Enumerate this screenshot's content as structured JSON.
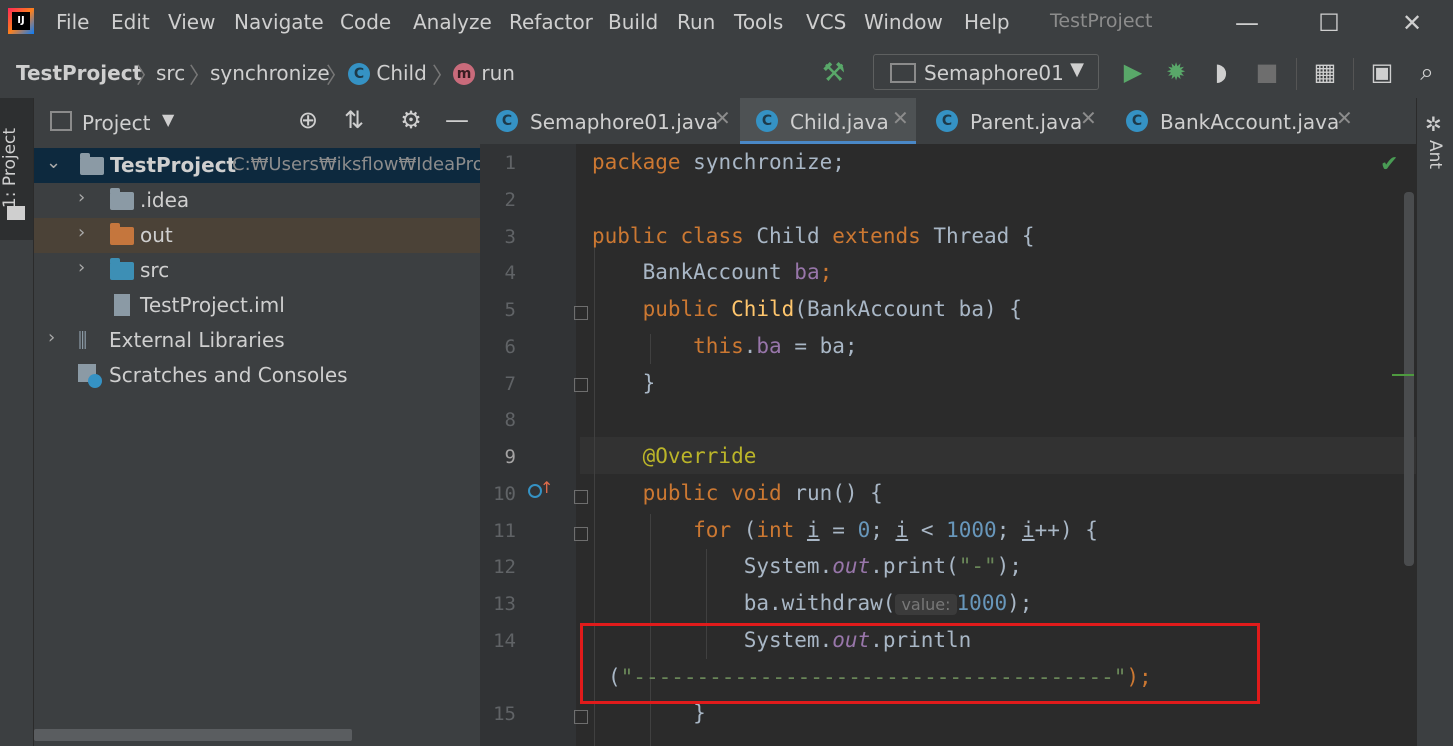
{
  "menubar": {
    "items": [
      "File",
      "Edit",
      "View",
      "Navigate",
      "Code",
      "Analyze",
      "Refactor",
      "Build",
      "Run",
      "Tools",
      "VCS",
      "Window",
      "Help"
    ],
    "window_title": "TestProject",
    "controls": {
      "minimize": "—",
      "maximize": "☐",
      "close": "✕"
    }
  },
  "breadcrumb": {
    "project": "TestProject",
    "folder": "src",
    "package": "synchronize",
    "class": "Child",
    "method": "run",
    "class_icon_letter": "C",
    "method_icon_letter": "m"
  },
  "toolbar": {
    "run_config": "Semaphore01",
    "icons": [
      "build-hammer-icon",
      "run-icon",
      "debug-icon",
      "coverage-icon",
      "stop-icon",
      "project-structure-icon",
      "terminal-icon",
      "search-icon"
    ]
  },
  "left_strip": {
    "tab_label": "1: Project"
  },
  "project_panel": {
    "title": "Project",
    "tree": [
      {
        "label": "TestProject",
        "path": "C:₩Users₩iksflow₩IdeaPro",
        "expanded": true
      },
      {
        "label": ".idea"
      },
      {
        "label": "out"
      },
      {
        "label": "src"
      },
      {
        "label": "TestProject.iml"
      },
      {
        "label": "External Libraries"
      },
      {
        "label": "Scratches and Consoles"
      }
    ]
  },
  "editor_tabs": [
    {
      "label": "Semaphore01.java",
      "active": false
    },
    {
      "label": "Child.java",
      "active": true
    },
    {
      "label": "Parent.java",
      "active": false
    },
    {
      "label": "BankAccount.java",
      "active": false
    }
  ],
  "editor": {
    "line_numbers": [
      "1",
      "2",
      "3",
      "4",
      "5",
      "6",
      "7",
      "8",
      "9",
      "10",
      "11",
      "12",
      "13",
      "14",
      "15"
    ],
    "current_line": "9",
    "code": {
      "l1_kw": "package",
      "l1_rest": " synchronize;",
      "l3_kw1": "public",
      "l3_kw2": "class",
      "l3_name": " Child ",
      "l3_kw3": "extends",
      "l3_rest": " Thread {",
      "l4_type": "BankAccount ",
      "l4_field": "ba",
      "l4_end": ";",
      "l5_kw": "public",
      "l5_name": "Child",
      "l5_rest": "(BankAccount ba) {",
      "l6_kw": "this",
      "l6_dot": ".",
      "l6_field": "ba",
      "l6_rest": " = ba;",
      "l7": "}",
      "l9_ann": "@Override",
      "l10_kw1": "public",
      "l10_kw2": "void",
      "l10_rest": " run() {",
      "l11_kw": "for",
      "l11_a": " (",
      "l11_int": "int",
      "l11_b": " ",
      "l11_i1": "i",
      "l11_c": " = ",
      "l11_n0": "0",
      "l11_d": "; ",
      "l11_i2": "i",
      "l11_e": " < ",
      "l11_n1000": "1000",
      "l11_f": "; ",
      "l11_i3": "i",
      "l11_g": "++) {",
      "l12_a": "System.",
      "l12_out": "out",
      "l12_b": ".print(",
      "l12_str": "\"-\"",
      "l12_c": ");",
      "l13_a": "ba.withdraw(",
      "l13_hint": "value:",
      "l13_num": "1000",
      "l13_b": ");",
      "l14_a": "System.",
      "l14_out": "out",
      "l14_b": ".println",
      "l14w_a": "(",
      "l14w_str": "\"--------------------------------------\"",
      "l14w_b": ");",
      "l15": "}"
    }
  },
  "right_strip": {
    "label": "Ant"
  },
  "colors": {
    "keyword": "#cc7832",
    "annotation": "#bbb529",
    "field": "#9876aa",
    "number": "#6897bb",
    "string": "#6a8759",
    "highlight_box": "#e01b1b"
  }
}
